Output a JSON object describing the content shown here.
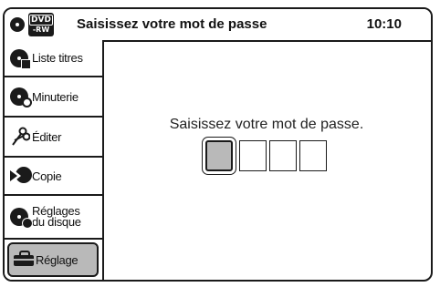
{
  "header": {
    "dvd_badge_top": "DVD",
    "dvd_badge_bottom": "-RW",
    "title": "Saisissez votre mot de passe",
    "time": "10:10"
  },
  "sidebar": {
    "items": [
      {
        "label": "Liste titres",
        "icon": "title-list-disc-icon"
      },
      {
        "label": "Minuterie",
        "icon": "timer-clock-icon"
      },
      {
        "label": "Éditer",
        "icon": "scissors-icon"
      },
      {
        "label": "Copie",
        "icon": "copy-disc-icon"
      },
      {
        "label_line1": "Réglages",
        "label_line2": "du disque",
        "icon": "disc-settings-icon"
      },
      {
        "label": "Réglage",
        "icon": "toolbox-icon",
        "selected": true
      }
    ]
  },
  "main": {
    "prompt": "Saisissez votre mot de passe.",
    "password_boxes": 4,
    "active_box_index": 0
  },
  "colors": {
    "border": "#1a1a1a",
    "highlight": "#b9b9b9",
    "background": "#ffffff"
  }
}
